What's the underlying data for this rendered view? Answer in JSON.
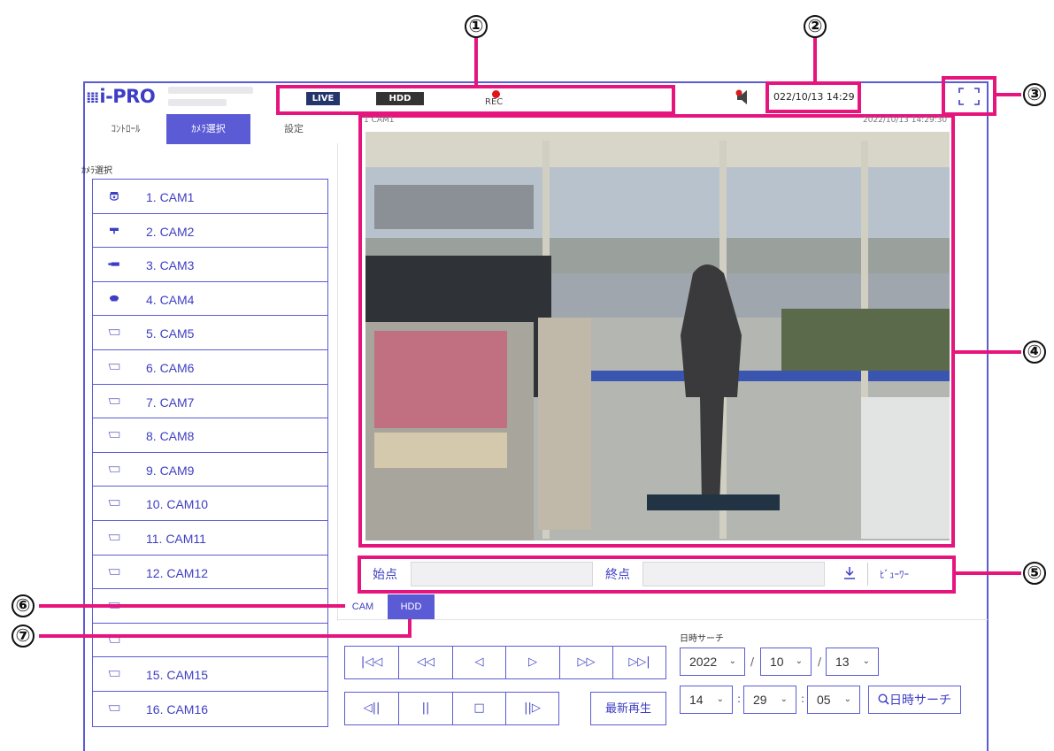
{
  "app": {
    "logo_text": "i-PRO"
  },
  "callouts": [
    "①",
    "②",
    "③",
    "④",
    "⑤",
    "⑥",
    "⑦"
  ],
  "status": {
    "live_label": "LIVE",
    "hdd_label": "HDD",
    "rec_label": "REC",
    "datetime": "022/10/13 14:29"
  },
  "tabs": [
    {
      "label": "ｺﾝﾄﾛｰﾙ"
    },
    {
      "label": "ｶﾒﾗ選択"
    },
    {
      "label": "設定"
    }
  ],
  "camera_select": {
    "heading": "ｶﾒﾗ選択",
    "cameras": [
      {
        "label": "1. CAM1",
        "icon": "dome-camera-icon"
      },
      {
        "label": "2. CAM2",
        "icon": "box-camera-icon"
      },
      {
        "label": "3. CAM3",
        "icon": "bullet-camera-icon"
      },
      {
        "label": "4. CAM4",
        "icon": "fisheye-camera-icon"
      },
      {
        "label": "5. CAM5",
        "icon": "camera-outline-icon"
      },
      {
        "label": "6. CAM6",
        "icon": "camera-outline-icon"
      },
      {
        "label": "7. CAM7",
        "icon": "camera-outline-icon"
      },
      {
        "label": "8. CAM8",
        "icon": "camera-outline-icon"
      },
      {
        "label": "9. CAM9",
        "icon": "camera-outline-icon"
      },
      {
        "label": "10. CAM10",
        "icon": "camera-outline-icon"
      },
      {
        "label": "11. CAM11",
        "icon": "camera-outline-icon"
      },
      {
        "label": "12. CAM12",
        "icon": "camera-outline-icon"
      },
      {
        "label": "",
        "icon": "camera-outline-icon"
      },
      {
        "label": "",
        "icon": "camera-outline-icon"
      },
      {
        "label": "15. CAM15",
        "icon": "camera-outline-icon"
      },
      {
        "label": "16. CAM16",
        "icon": "camera-outline-icon"
      }
    ]
  },
  "video": {
    "overlay_left": "1 CAM1",
    "overlay_right": "2022/10/13 14:29:30"
  },
  "range": {
    "start_label": "始点",
    "end_label": "終点",
    "download_icon": "download-icon",
    "viewer_label": "ﾋﾞｭｰﾜｰ"
  },
  "source_tabs": [
    {
      "label": "CAM"
    },
    {
      "label": "HDD"
    }
  ],
  "playback": {
    "row1": [
      {
        "glyph": "|◁◁",
        "name": "skip-to-first-button"
      },
      {
        "glyph": "◁◁",
        "name": "fast-reverse-button"
      },
      {
        "glyph": "◁",
        "name": "reverse-play-button"
      },
      {
        "glyph": "▷",
        "name": "play-button"
      },
      {
        "glyph": "▷▷",
        "name": "fast-forward-button"
      },
      {
        "glyph": "▷▷|",
        "name": "skip-to-last-button"
      }
    ],
    "row2": [
      {
        "glyph": "◁||",
        "name": "frame-back-button"
      },
      {
        "glyph": "||",
        "name": "pause-button"
      },
      {
        "glyph": "□",
        "name": "stop-button"
      },
      {
        "glyph": "||▷",
        "name": "frame-forward-button"
      }
    ],
    "latest_label": "最新再生"
  },
  "datetime_search": {
    "label": "日時サーチ",
    "year": "2022",
    "month": "10",
    "day": "13",
    "hour": "14",
    "minute": "29",
    "second": "05",
    "date_sep": "/",
    "time_sep": ":",
    "search_label": "日時サーチ"
  }
}
